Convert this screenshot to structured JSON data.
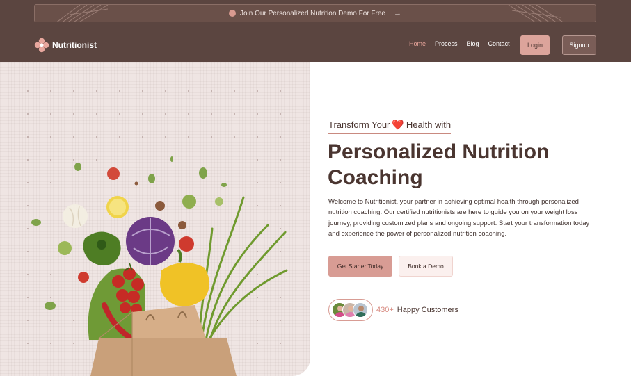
{
  "banner": {
    "text": "Join Our Personalized Nutrition Demo For Free",
    "arrow": "→"
  },
  "brand": {
    "name": "Nutritionist"
  },
  "nav": [
    {
      "label": "Home",
      "active": true
    },
    {
      "label": "Process",
      "active": false
    },
    {
      "label": "Blog",
      "active": false
    },
    {
      "label": "Contact",
      "active": false
    }
  ],
  "auth": {
    "login": "Login",
    "signup": "Signup"
  },
  "hero": {
    "eyebrow_before": "Transform Your",
    "eyebrow_heart": "❤️",
    "eyebrow_after": "Health with",
    "title": "Personalized Nutrition Coaching",
    "description": "Welcome to Nutritionist, your partner in achieving optimal health through personalized nutrition coaching. Our certified nutritionists are here to guide you on your weight loss journey, providing customized plans and ongoing support. Start your transformation today and experience the power of personalized nutrition coaching.",
    "cta_primary": "Get Starter Today",
    "cta_secondary": "Book a Demo",
    "customers_count": "430+",
    "customers_label": "Happy Customers"
  },
  "colors": {
    "header_bg": "#5b4540",
    "accent": "#d89c94",
    "heading": "#4a3530",
    "hero_bg": "#efe5e3"
  }
}
